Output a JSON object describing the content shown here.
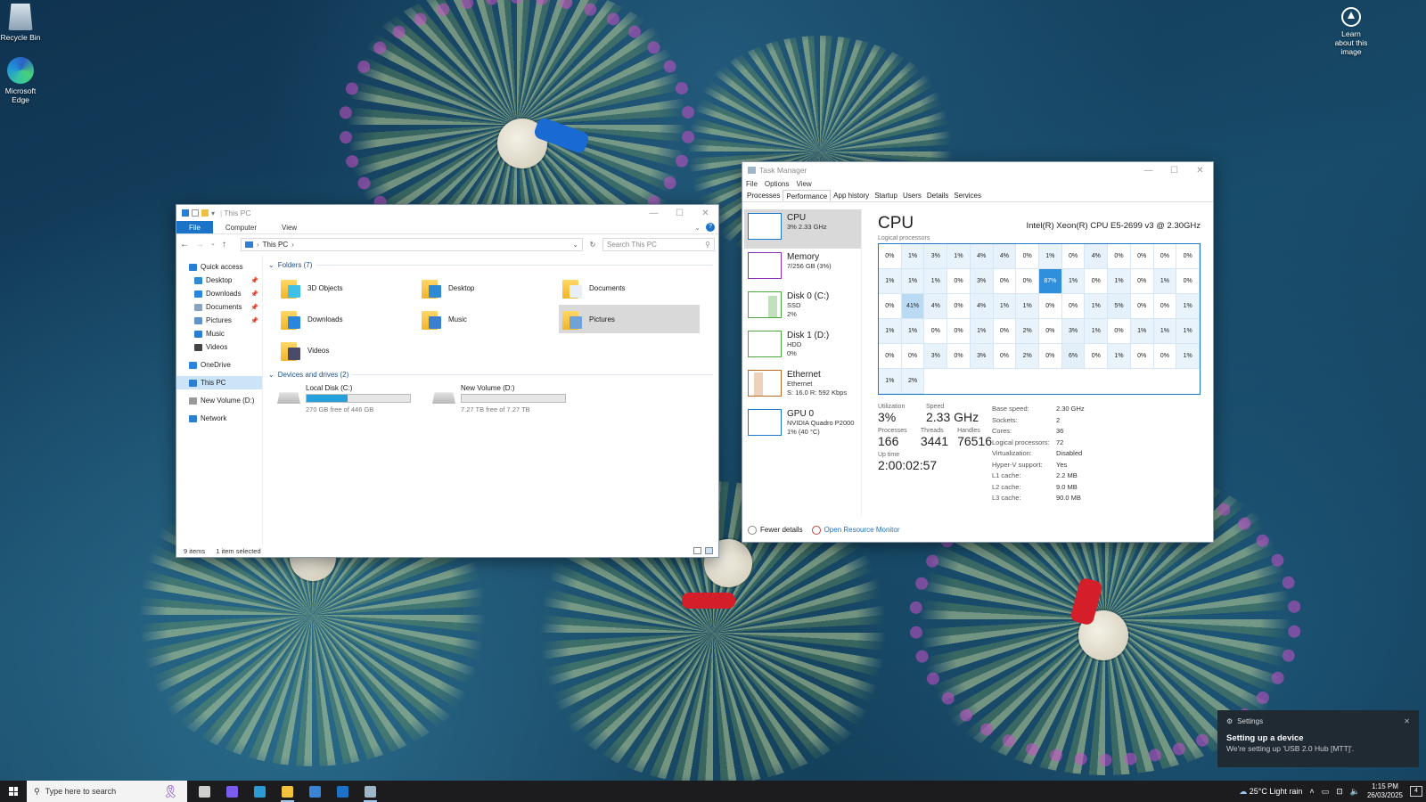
{
  "desktop": {
    "recycle_bin": "Recycle Bin",
    "edge": "Microsoft Edge",
    "learn": "Learn about this image"
  },
  "explorer": {
    "title": "This PC",
    "tabs": [
      "File",
      "Computer",
      "View"
    ],
    "address": "This PC",
    "search_placeholder": "Search This PC",
    "nav": [
      {
        "label": "Quick access",
        "icon": "star-icon",
        "pinned": false,
        "indent": 0
      },
      {
        "label": "Desktop",
        "icon": "desktop-icon",
        "pinned": true,
        "indent": 1
      },
      {
        "label": "Downloads",
        "icon": "downloads-icon",
        "pinned": true,
        "indent": 1
      },
      {
        "label": "Documents",
        "icon": "documents-icon",
        "pinned": true,
        "indent": 1
      },
      {
        "label": "Pictures",
        "icon": "pictures-icon",
        "pinned": true,
        "indent": 1
      },
      {
        "label": "Music",
        "icon": "music-icon",
        "pinned": false,
        "indent": 1
      },
      {
        "label": "Videos",
        "icon": "videos-icon",
        "pinned": false,
        "indent": 1
      },
      {
        "label": "OneDrive",
        "icon": "cloud-icon",
        "pinned": false,
        "indent": 0
      },
      {
        "label": "This PC",
        "icon": "computer-icon",
        "pinned": false,
        "indent": 0
      },
      {
        "label": "New Volume (D:)",
        "icon": "drive-icon",
        "pinned": false,
        "indent": 0
      },
      {
        "label": "Network",
        "icon": "network-icon",
        "pinned": false,
        "indent": 0
      }
    ],
    "folders_heading": "Folders (7)",
    "folders": [
      {
        "label": "3D Objects",
        "overlay": "#3ec0e8"
      },
      {
        "label": "Desktop",
        "overlay": "#2f8ad6"
      },
      {
        "label": "Documents",
        "overlay": "#e8eef6"
      },
      {
        "label": "Downloads",
        "overlay": "#2a86dc"
      },
      {
        "label": "Music",
        "overlay": "#3a7fd0"
      },
      {
        "label": "Pictures",
        "overlay": "#6fa3d8"
      },
      {
        "label": "Videos",
        "overlay": "#4a4a6a"
      }
    ],
    "selected_folder": "Pictures",
    "devices_heading": "Devices and drives (2)",
    "drives": [
      {
        "label": "Local Disk (C:)",
        "free": "270 GB free of 446 GB",
        "used_fraction": 0.395
      },
      {
        "label": "New Volume (D:)",
        "free": "7.27 TB free of 7.27 TB",
        "used_fraction": 0.0
      }
    ],
    "status_items": "9 items",
    "status_selected": "1 item selected"
  },
  "taskmgr": {
    "title": "Task Manager",
    "menu": [
      "File",
      "Options",
      "View"
    ],
    "tabs": [
      "Processes",
      "Performance",
      "App history",
      "Startup",
      "Users",
      "Details",
      "Services"
    ],
    "active_tab": "Performance",
    "resources": [
      {
        "name": "CPU",
        "sub1": "3% 2.33 GHz",
        "sub2": "",
        "sub3": "",
        "color": "#1979ca"
      },
      {
        "name": "Memory",
        "sub1": "7/256 GB (3%)",
        "sub2": "",
        "sub3": "",
        "color": "#8b2fb8"
      },
      {
        "name": "Disk 0 (C:)",
        "sub1": "SSD",
        "sub2": "2%",
        "sub3": "",
        "color": "#4da840"
      },
      {
        "name": "Disk 1 (D:)",
        "sub1": "HDD",
        "sub2": "0%",
        "sub3": "",
        "color": "#4da840"
      },
      {
        "name": "Ethernet",
        "sub1": "Ethernet",
        "sub2": "S: 16.0  R: 592 Kbps",
        "sub3": "",
        "color": "#c06a20"
      },
      {
        "name": "GPU 0",
        "sub1": "NVIDIA Quadro P2000",
        "sub2": "1% (40 °C)",
        "sub3": "",
        "color": "#1979ca"
      }
    ],
    "cpu_title": "CPU",
    "cpu_model": "Intel(R) Xeon(R) CPU E5-2699 v3 @ 2.30GHz",
    "logical_label": "Logical processors",
    "cores": [
      0,
      1,
      3,
      1,
      4,
      4,
      0,
      1,
      0,
      4,
      0,
      0,
      0,
      0,
      1,
      1,
      1,
      0,
      3,
      0,
      0,
      87,
      1,
      0,
      1,
      0,
      1,
      0,
      0,
      41,
      4,
      0,
      4,
      1,
      1,
      0,
      0,
      1,
      5,
      0,
      0,
      1,
      1,
      1,
      0,
      0,
      1,
      0,
      2,
      0,
      3,
      1,
      0,
      1,
      1,
      1,
      0,
      0,
      3,
      0,
      3,
      0,
      2,
      0,
      6,
      0,
      1,
      0,
      0,
      1,
      1,
      2
    ],
    "utilization_label": "Utilization",
    "utilization": "3%",
    "speed_label": "Speed",
    "speed": "2.33 GHz",
    "processes_label": "Processes",
    "processes": "166",
    "threads_label": "Threads",
    "threads": "3441",
    "handles_label": "Handles",
    "handles": "76516",
    "uptime_label": "Up time",
    "uptime": "2:00:02:57",
    "specs": [
      {
        "k": "Base speed:",
        "v": "2.30 GHz"
      },
      {
        "k": "Sockets:",
        "v": "2"
      },
      {
        "k": "Cores:",
        "v": "36"
      },
      {
        "k": "Logical processors:",
        "v": "72"
      },
      {
        "k": "Virtualization:",
        "v": "Disabled"
      },
      {
        "k": "Hyper-V support:",
        "v": "Yes"
      },
      {
        "k": "L1 cache:",
        "v": "2.2 MB"
      },
      {
        "k": "L2 cache:",
        "v": "9.0 MB"
      },
      {
        "k": "L3 cache:",
        "v": "90.0 MB"
      }
    ],
    "fewer_details": "Fewer details",
    "open_resmon": "Open Resource Monitor"
  },
  "toast": {
    "app": "Settings",
    "title": "Setting up a device",
    "body": "We're setting up 'USB 2.0 Hub [MTT]'."
  },
  "taskbar": {
    "search_placeholder": "Type here to search",
    "weather": "25°C  Light rain",
    "time": "1:15 PM",
    "date": "26/03/2025",
    "notif_count": "4",
    "apps": [
      {
        "name": "task-view-icon",
        "color": "#cfcfcf",
        "running": false
      },
      {
        "name": "copilot-icon",
        "color": "#7c5cf0",
        "running": false
      },
      {
        "name": "edge-icon",
        "color": "#2b9bd6",
        "running": false
      },
      {
        "name": "file-explorer-icon",
        "color": "#f2c23c",
        "running": true
      },
      {
        "name": "store-icon",
        "color": "#3a84d6",
        "running": false
      },
      {
        "name": "outlook-icon",
        "color": "#1a73c7",
        "running": false
      },
      {
        "name": "task-manager-icon",
        "color": "#9fb6c9",
        "running": true
      }
    ]
  }
}
